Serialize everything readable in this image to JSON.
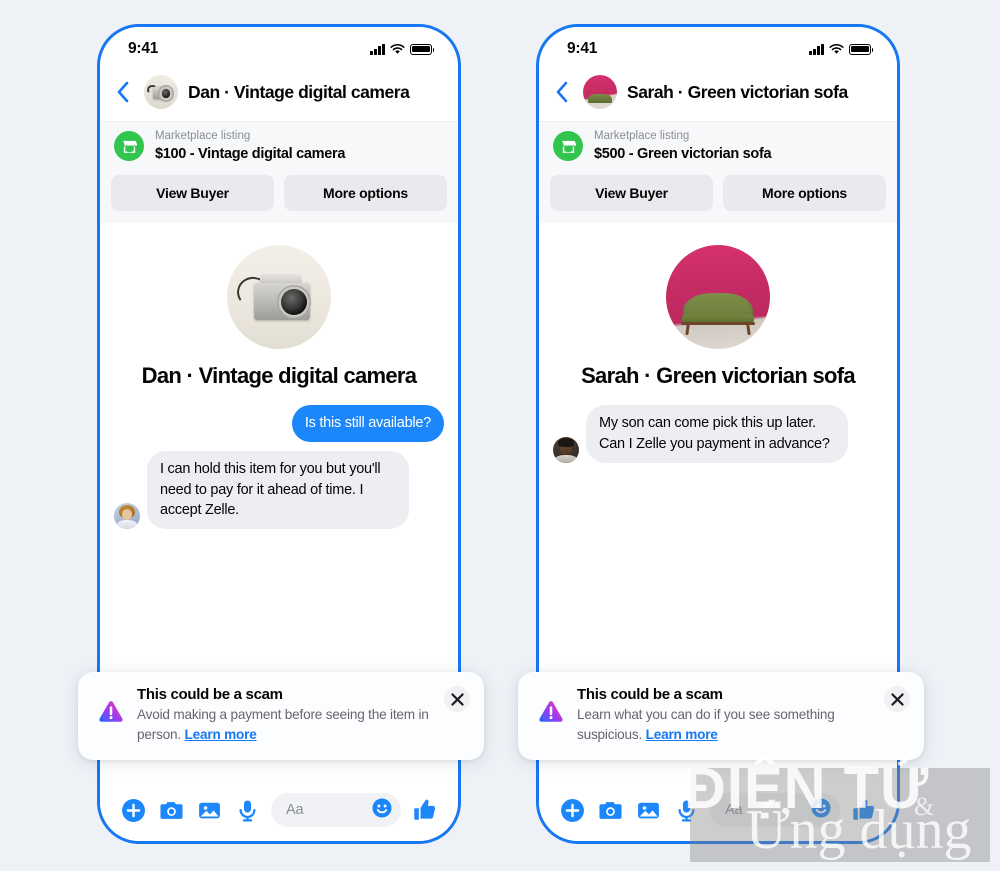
{
  "page": {
    "background_color": "#eef2f7",
    "accent_blue": "#1877f2",
    "bubble_blue": "#1b87fa",
    "marketplace_green": "#31c54f"
  },
  "watermark": {
    "line1": "ĐIỆN TỬ",
    "ampersand": "&",
    "line2": "Ứng dụng"
  },
  "phones": [
    {
      "id": "left",
      "status_bar": {
        "time": "9:41",
        "cellular_icon": "signal-bars-icon",
        "wifi_icon": "wifi-icon",
        "battery_icon": "battery-full-icon"
      },
      "header": {
        "back_icon": "chevron-left-icon",
        "avatar_icon": "listing-photo-camera",
        "title": "Dan · Vintage digital camera"
      },
      "listing": {
        "icon": "marketplace-storefront-icon",
        "label": "Marketplace listing",
        "detail": "$100 - Vintage digital camera"
      },
      "actions": {
        "primary": "View Buyer",
        "secondary": "More options"
      },
      "intro": {
        "avatar_icon": "listing-photo-camera",
        "name": "Dan · Vintage digital camera"
      },
      "messages": [
        {
          "direction": "out",
          "text": "Is this still available?",
          "avatar_icon": ""
        },
        {
          "direction": "in",
          "text": "I can hold this item for you but you'll need to pay for it ahead of time. I accept Zelle.",
          "avatar_icon": "avatar-dan"
        }
      ],
      "warning": {
        "icon": "warning-triangle-icon",
        "title": "This could be a scam",
        "body": "Avoid making a payment before seeing the item in person. ",
        "link": "Learn more",
        "close_icon": "close-icon"
      },
      "composer": {
        "plus_icon": "plus-circle-icon",
        "camera_icon": "camera-icon",
        "gallery_icon": "image-icon",
        "mic_icon": "microphone-icon",
        "placeholder": "Aa",
        "emoji_icon": "smiley-icon",
        "thumb_icon": "thumbs-up-icon"
      }
    },
    {
      "id": "right",
      "status_bar": {
        "time": "9:41",
        "cellular_icon": "signal-bars-icon",
        "wifi_icon": "wifi-icon",
        "battery_icon": "battery-full-icon"
      },
      "header": {
        "back_icon": "chevron-left-icon",
        "avatar_icon": "listing-photo-sofa",
        "title": "Sarah · Green victorian sofa"
      },
      "listing": {
        "icon": "marketplace-storefront-icon",
        "label": "Marketplace listing",
        "detail": "$500 - Green victorian sofa"
      },
      "actions": {
        "primary": "View Buyer",
        "secondary": "More options"
      },
      "intro": {
        "avatar_icon": "listing-photo-sofa",
        "name": "Sarah · Green victorian sofa"
      },
      "messages": [
        {
          "direction": "in",
          "text": "My son can come pick this up later. Can I Zelle you payment in advance?",
          "avatar_icon": "avatar-sarah"
        }
      ],
      "warning": {
        "icon": "warning-triangle-icon",
        "title": "This could be a scam",
        "body": "Learn what you can do if you see something suspicious. ",
        "link": "Learn more",
        "close_icon": "close-icon"
      },
      "composer": {
        "plus_icon": "plus-circle-icon",
        "camera_icon": "camera-icon",
        "gallery_icon": "image-icon",
        "mic_icon": "microphone-icon",
        "placeholder": "Aa",
        "emoji_icon": "smiley-icon",
        "thumb_icon": "thumbs-up-icon"
      }
    }
  ]
}
